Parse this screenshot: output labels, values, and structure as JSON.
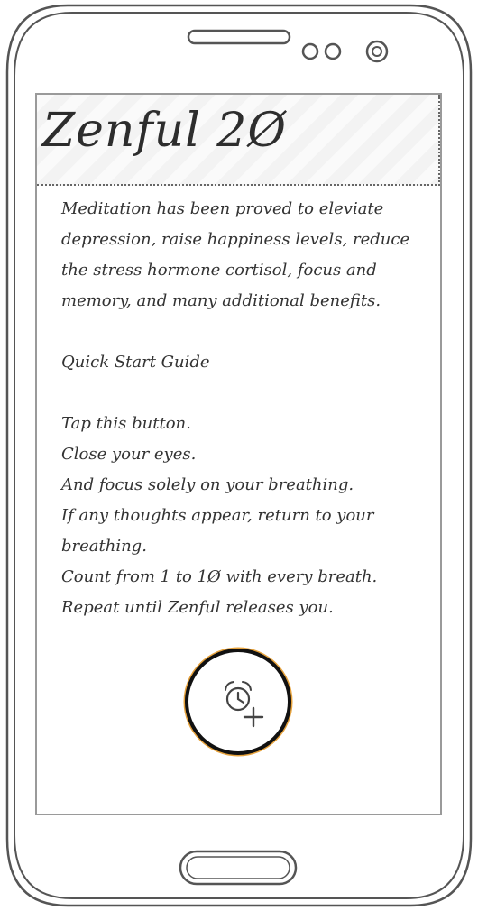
{
  "app": {
    "title": "Zenful 2Ø"
  },
  "intro": {
    "text": "Meditation has been proved to eleviate depression, raise happiness levels, reduce the stress hormone cortisol, focus and memory, and many additional benefits."
  },
  "guide": {
    "heading": "Quick Start Guide",
    "steps": [
      "Tap this button.",
      "Close your eyes.",
      "And focus solely on your breathing.",
      "If any thoughts appear, return to your breathing.",
      "Count from 1 to 1Ø with every breath.",
      "Repeat until Zenful releases you."
    ]
  },
  "timer_button": {
    "icon": "add-alarm-icon",
    "accent": "#e6a23c"
  },
  "device": {
    "frame_color": "#555555",
    "screen_border": "#9a9a9a"
  }
}
